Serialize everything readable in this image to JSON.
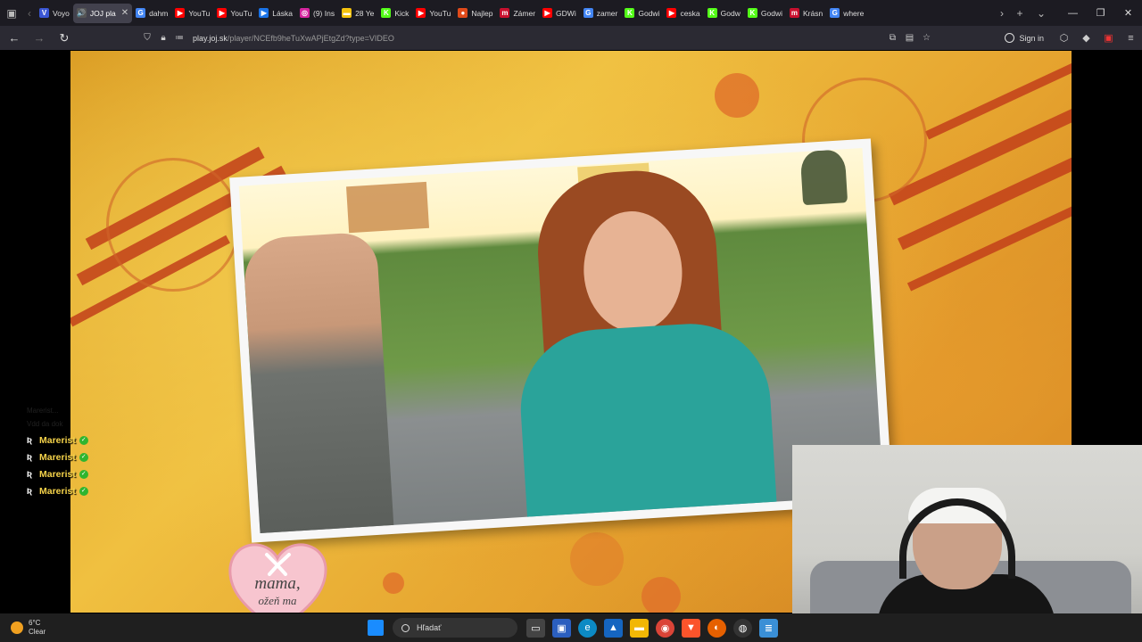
{
  "browser": {
    "tabs": [
      {
        "label": "Voyo",
        "color": "#3a56d4",
        "glyph": "V",
        "active": false
      },
      {
        "label": "JOJ pla",
        "color": "#555555",
        "glyph": "🔊",
        "active": true
      },
      {
        "label": "dahm",
        "color": "#4285f4",
        "glyph": "G",
        "active": false
      },
      {
        "label": "YouTu",
        "color": "#ff0000",
        "glyph": "▶",
        "active": false
      },
      {
        "label": "YouTu",
        "color": "#ff0000",
        "glyph": "▶",
        "active": false
      },
      {
        "label": "Láska",
        "color": "#1a73e8",
        "glyph": "▶",
        "active": false
      },
      {
        "label": "(9) Ins",
        "color": "#d6249f",
        "glyph": "◎",
        "active": false
      },
      {
        "label": "28 Ye",
        "color": "#f4c20d",
        "glyph": "▬",
        "active": false
      },
      {
        "label": "Kick",
        "color": "#53fc18",
        "glyph": "K",
        "active": false
      },
      {
        "label": "YouTu",
        "color": "#ff0000",
        "glyph": "▶",
        "active": false
      },
      {
        "label": "Najlep",
        "color": "#e04a1a",
        "glyph": "●",
        "active": false
      },
      {
        "label": "Zámer",
        "color": "#c8102e",
        "glyph": "m",
        "active": false
      },
      {
        "label": "GDWi",
        "color": "#ff0000",
        "glyph": "▶",
        "active": false
      },
      {
        "label": "zamer",
        "color": "#4285f4",
        "glyph": "G",
        "active": false
      },
      {
        "label": "Godwi",
        "color": "#53fc18",
        "glyph": "K",
        "active": false
      },
      {
        "label": "ceska",
        "color": "#ff0000",
        "glyph": "▶",
        "active": false
      },
      {
        "label": "Godw",
        "color": "#53fc18",
        "glyph": "K",
        "active": false
      },
      {
        "label": "Godwi",
        "color": "#53fc18",
        "glyph": "K",
        "active": false
      },
      {
        "label": "Krásn",
        "color": "#c8102e",
        "glyph": "m",
        "active": false
      },
      {
        "label": "where",
        "color": "#4285f4",
        "glyph": "G",
        "active": false
      }
    ],
    "url_domain": "play.joj.sk",
    "url_path": "/player/NCEfb9heTuXwAPjEtgZd?type=VIDEO",
    "signin_label": "Sign in"
  },
  "overlay_chat": {
    "faint_lines": [
      "Marerist...",
      "Vdd da dok"
    ],
    "messages": [
      {
        "user": "Marerist"
      },
      {
        "user": "Marerist"
      },
      {
        "user": "Marerist"
      },
      {
        "user": "Marerist"
      }
    ]
  },
  "show_logo": {
    "line1": "mama,",
    "line2": "ožeň ma"
  },
  "taskbar": {
    "weather_temp": "6°C",
    "weather_desc": "Clear",
    "search_placeholder": "Hľadať"
  }
}
